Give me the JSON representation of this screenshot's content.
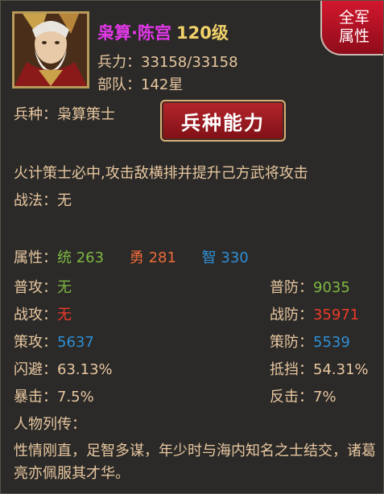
{
  "character": {
    "name": "枭算·陈宫",
    "level": "120级",
    "troops_label": "兵力：",
    "troops_value": "33158/33158",
    "unit_label": "部队：",
    "unit_value": "142星",
    "type_label": "兵种：",
    "type_value": "枭算策士"
  },
  "badge": {
    "line1": "全军",
    "line2": "属性"
  },
  "ability_button": "兵种能力",
  "description": "火计策士必中,攻击敌横排并提升己方武将攻击",
  "tactic": {
    "label": "战法：",
    "value": "无"
  },
  "attributes": {
    "label": "属性：",
    "tong_label": "统",
    "tong_value": "263",
    "yong_label": "勇",
    "yong_value": "281",
    "zhi_label": "智",
    "zhi_value": "330"
  },
  "stats": [
    {
      "label": "普攻：",
      "value": "无",
      "label2": "普防：",
      "value2": "9035"
    },
    {
      "label": "战攻：",
      "value": "无",
      "label2": "战防：",
      "value2": "35971"
    },
    {
      "label": "策攻：",
      "value": "5637",
      "label2": "策防：",
      "value2": "5539"
    },
    {
      "label": "闪避：",
      "value": "63.13%",
      "label2": "抵挡：",
      "value2": "54.31%"
    },
    {
      "label": "暴击：",
      "value": "7.5%",
      "label2": "反击：",
      "value2": "7%"
    }
  ],
  "biography": {
    "label": "人物列传：",
    "text": "性情刚直，足智多谋，年少时与海内知名之士结交，诸葛亮亦佩服其才华。"
  },
  "colors": {
    "name": "#e238e8",
    "level": "#f2d26a",
    "green": "#7fb743",
    "red": "#ee3a28",
    "orange": "#ed6a3a",
    "blue": "#2f8fd6",
    "badge": "#c9142a"
  }
}
